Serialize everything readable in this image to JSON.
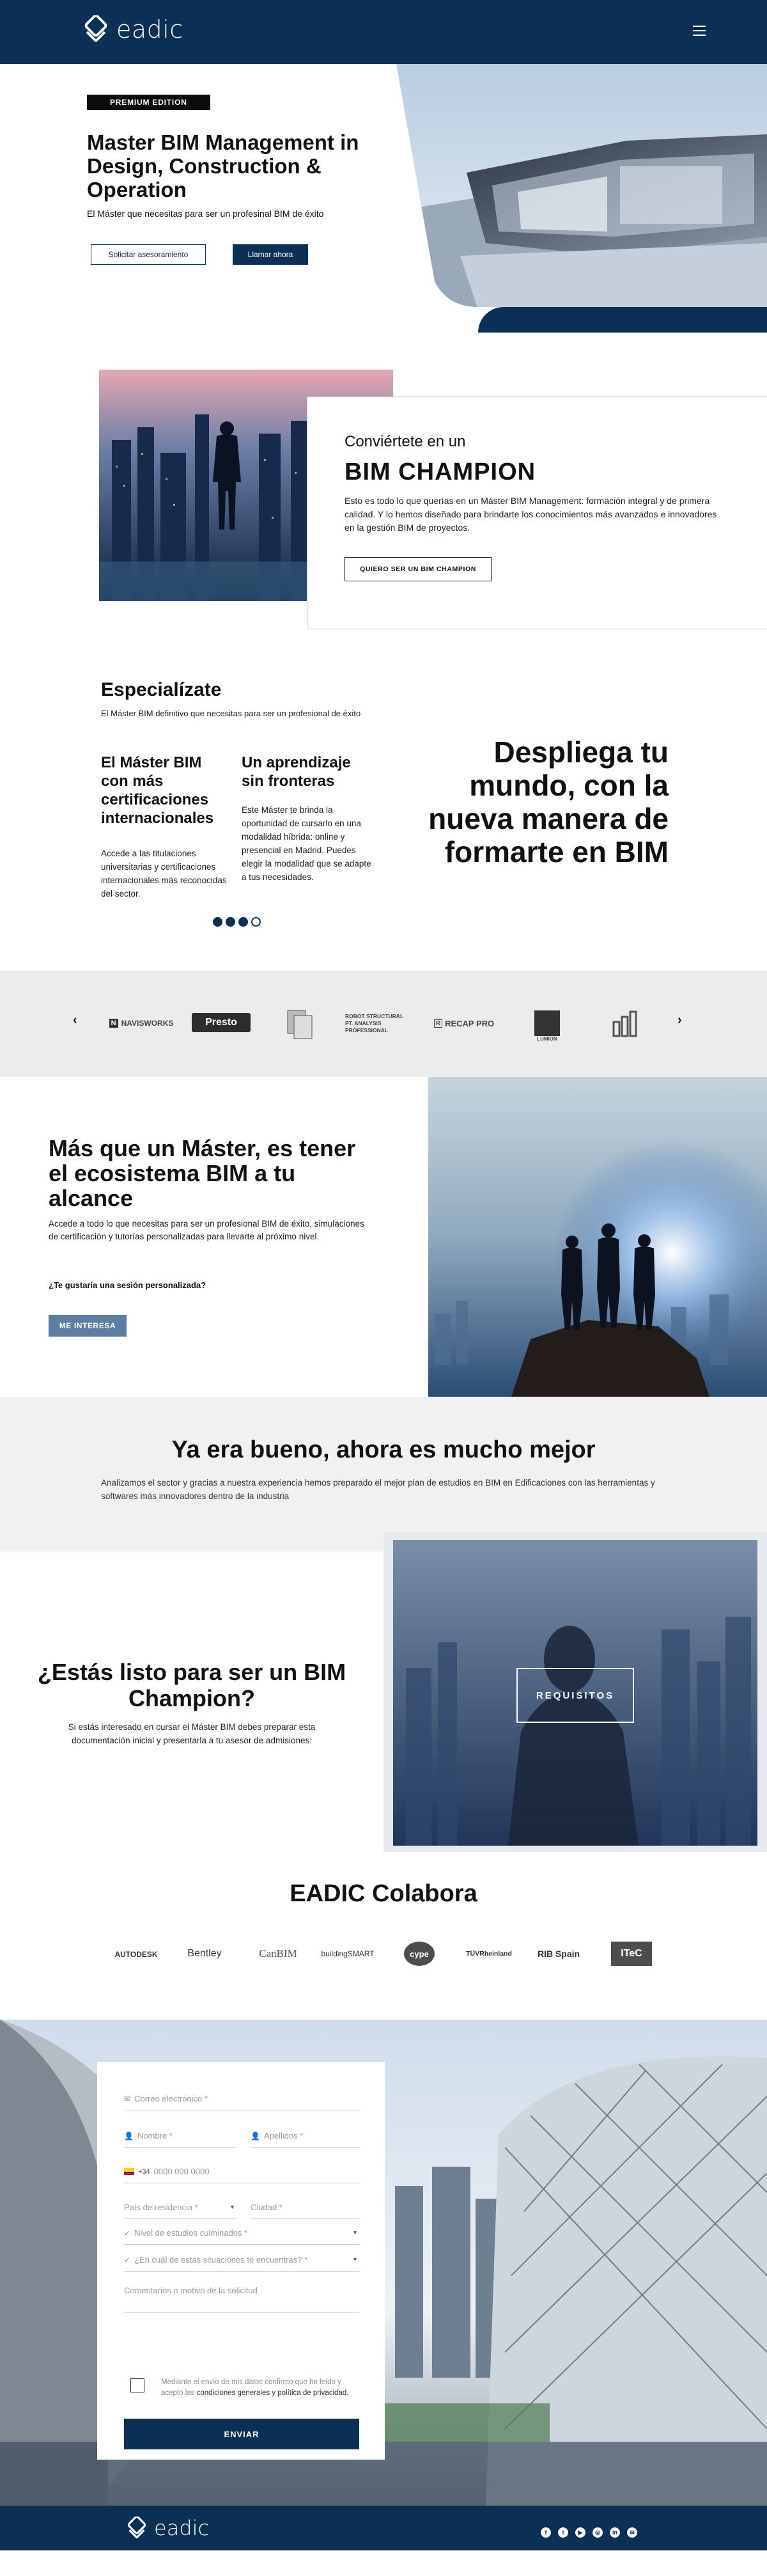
{
  "header": {
    "logo_text": "eadic"
  },
  "hero": {
    "badge": "PREMIUM EDITION",
    "title": "Master BIM Management in Design, Construction & Operation",
    "subtitle": "El Máster que necesitas para ser un profesinal BIM de éxito",
    "btn_advice": "Solicitar asesoramiento",
    "btn_call": "Llamar ahora"
  },
  "champion": {
    "pre": "Conviértete en un",
    "title": "BIM CHAMPION",
    "text": "Esto es todo lo que querías en un Máster BIM Management: formación integral y de primera calidad. Y lo hemos diseñado para brindarte los conocimientos más avanzados e innovadores en la gestión BIM de proyectos.",
    "button": "QUIERO SER UN BIM CHAMPION"
  },
  "specialize": {
    "title": "Especialízate",
    "subtitle": "El Máster BIM definitivo que necesitas para ser un profesional de éxito",
    "col1_title": "El Máster BIM con más certificaciones internacionales",
    "col1_text": "Accede a las titulaciones universitarias y certificaciones internacionales más reconocidas del sector.",
    "col2_title": "Un aprendizaje sin fronteras",
    "col2_text": "Este Máster te brinda la oportunidad de cursarlo en una modalidad híbrida: online y presencial en Madrid. Puedes elegir la modalidad que se adapte a tus necesidades.",
    "big_text": "Despliega tu mundo, con la nueva manera de formarte en BIM"
  },
  "software": {
    "prev": "‹",
    "next": "›",
    "logos": [
      "NAVISWORKS",
      "Presto",
      "ROBOT STRUCTURAL",
      "PT. ANALYSIS PROFESSIONAL",
      "RECAP PRO",
      "LUMION"
    ]
  },
  "ecosystem": {
    "title": "Más que un Máster, es tener el ecosistema BIM a tu alcance",
    "text": "Accede a todo lo que necesitas para ser un profesional BIM de éxito, simulaciones de certificación y tutorías personalizadas para llevarte al próximo nivel.",
    "question": "¿Te gustaría una sesión personalizada?",
    "button": "ME INTERESA"
  },
  "better": {
    "title": "Ya era bueno, ahora es mucho mejor",
    "text": "Analizamos el sector y gracias a nuestra experiencia hemos preparado el mejor plan de estudios en BIM en Edificaciones con las herramientas y softwares más innovadores dentro de la industria"
  },
  "ready": {
    "title": "¿Estás listo para ser un BIM Champion?",
    "text": "Si estás interesado en cursar el Máster BIM debes preparar esta documentación inicial y presentarla a tu asesor de admisiones:",
    "button": "REQUISITOS"
  },
  "collab": {
    "title": "EADIC Colabora",
    "partners": [
      "AUTODESK",
      "Bentley",
      "CanBIM",
      "buildingSMART",
      "cype",
      "TÜVRheinland",
      "RIB Spain",
      "ITeC"
    ]
  },
  "form": {
    "email": "Correo electrónico *",
    "name": "Nombre *",
    "surname": "Apellidos *",
    "prefix": "+34",
    "phone": "0000 000 0000",
    "country": "País de residencia *",
    "city": "Ciudad *",
    "studies": "Nivel de estudios culminados *",
    "situation": "¿En cuál de estas situaciones te encuentras? *",
    "comments": "Comentarios o motivo de la solicitud",
    "consent_a": "Mediante el envío de mis datos confirmo que he leído y acepto las ",
    "consent_b": "condiciones generales y política de privacidad.",
    "submit": "ENVIAR"
  },
  "footer": {
    "logo_text": "eadic"
  }
}
